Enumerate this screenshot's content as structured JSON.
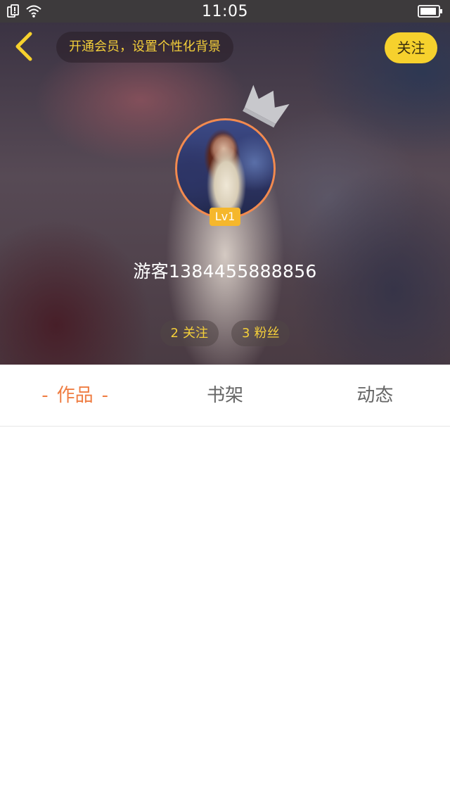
{
  "status_bar": {
    "time": "11:05",
    "icons": [
      "notification-icon",
      "wifi-icon",
      "battery-icon"
    ]
  },
  "header": {
    "back_icon": "chevron-left-icon",
    "vip_banner": "开通会员，设置个性化背景",
    "follow_button": "关注",
    "crown_icon": "crown-icon",
    "level_badge": "Lv1",
    "username": "游客1384455888856",
    "stats": {
      "following_count": "2",
      "following_label": "关注",
      "followers_count": "3",
      "followers_label": "粉丝"
    }
  },
  "tabs": [
    {
      "label": "作品",
      "active": true,
      "dash": "-"
    },
    {
      "label": "书架",
      "active": false
    },
    {
      "label": "动态",
      "active": false
    }
  ],
  "colors": {
    "accent_orange": "#ef7d43",
    "accent_yellow": "#f6d12d",
    "badge_gold": "#f5b72c",
    "status_bar": "#3d3a3c"
  }
}
